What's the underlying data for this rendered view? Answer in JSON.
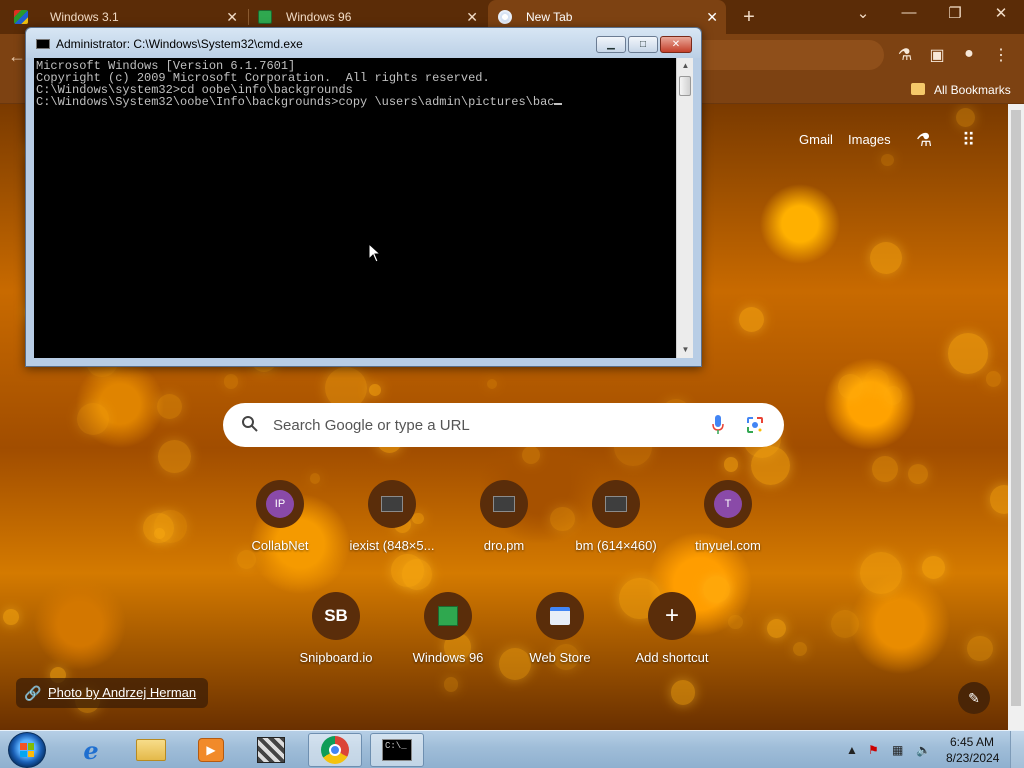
{
  "browser": {
    "tabs": [
      {
        "title": "Windows 3.1",
        "icon": "windows31-icon"
      },
      {
        "title": "Windows 96",
        "icon": "windows96-icon"
      },
      {
        "title": "New Tab",
        "icon": "chrome-icon",
        "active": true
      }
    ],
    "bookmarks": {
      "all_bookmarks_label": "All Bookmarks"
    }
  },
  "ntp": {
    "links": {
      "gmail": "Gmail",
      "images": "Images"
    },
    "search_placeholder": "Search Google or type a URL",
    "shortcuts": [
      {
        "label": "CollabNet",
        "avatar": "IP",
        "icon": "avatar-icon"
      },
      {
        "label": "iexist (848×5...",
        "icon": "page-thumbnail-icon"
      },
      {
        "label": "dro.pm",
        "icon": "page-thumbnail-icon"
      },
      {
        "label": "bm (614×460)",
        "icon": "page-thumbnail-icon"
      },
      {
        "label": "tinyuel.com",
        "avatar": "T",
        "icon": "avatar-icon"
      },
      {
        "label": "Snipboard.io",
        "avatar": "SB",
        "icon": "snipboard-icon"
      },
      {
        "label": "Windows 96",
        "icon": "windows96-icon"
      },
      {
        "label": "Web Store",
        "icon": "webstore-icon"
      },
      {
        "label": "Add shortcut",
        "icon": "plus-icon"
      }
    ],
    "photo_credit": "Photo by Andrzej Herman"
  },
  "cmd": {
    "title": "Administrator: C:\\Windows\\System32\\cmd.exe",
    "lines": [
      "Microsoft Windows [Version 6.1.7601]",
      "Copyright (c) 2009 Microsoft Corporation.  All rights reserved.",
      "",
      "C:\\Windows\\system32>cd oobe\\info\\backgrounds",
      "",
      "C:\\Windows\\System32\\oobe\\Info\\backgrounds>copy \\users\\admin\\pictures\\bac"
    ]
  },
  "taskbar": {
    "pinned": [
      "internet-explorer-icon",
      "file-explorer-icon",
      "media-player-icon",
      "program-icon",
      "chrome-icon",
      "cmd-icon"
    ],
    "clock": {
      "time": "6:45 AM",
      "date": "8/23/2024"
    }
  },
  "colors": {
    "chrome_frame": "#5b2c07",
    "toolbar": "#7d4212",
    "cmd_background": "#000000",
    "taskbar": "#9fbdd8"
  }
}
